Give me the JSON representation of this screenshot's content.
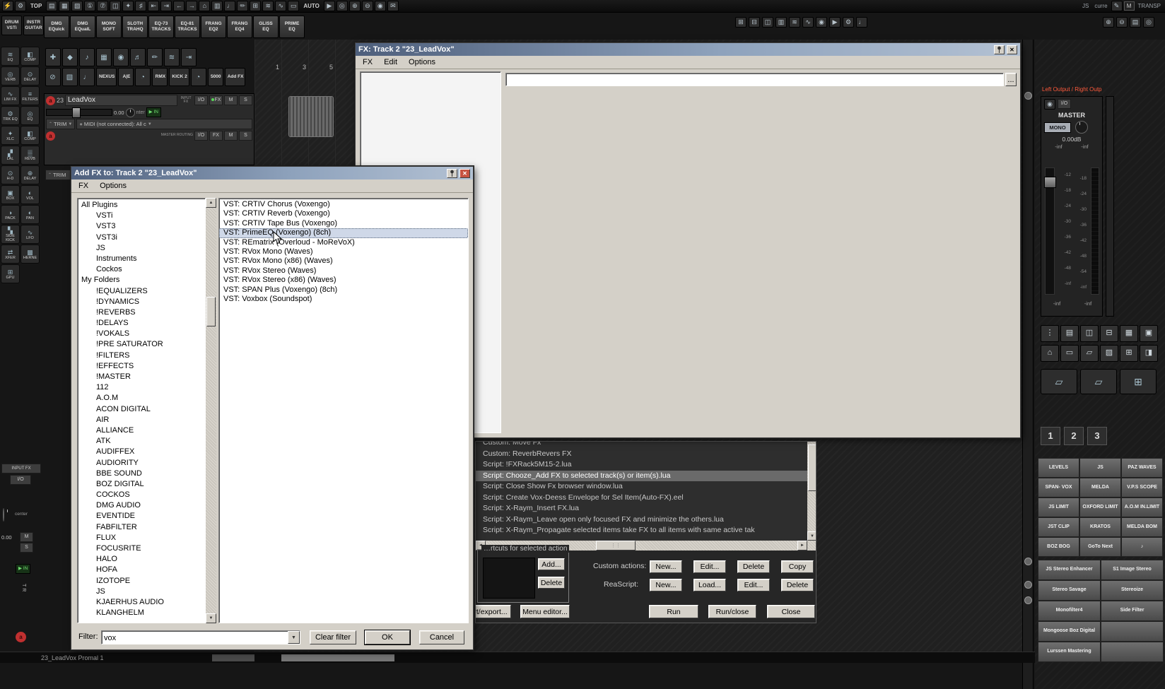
{
  "colors": {
    "titlebar_gradient_start": "#4e5f7c",
    "titlebar_gradient_end": "#b3c1d3",
    "window_chrome": "#d4d0c8",
    "selection_highlight": "#cfd8e8",
    "actions_selection": "#6a6a6a",
    "record_red": "#c03030",
    "output_label_red": "#ff5a3c",
    "monitor_green": "#6fe06f"
  },
  "top_toolbar": {
    "icons": [
      {
        "g": "⚡",
        "n": "actions-icon"
      },
      {
        "g": "⚙",
        "n": "gear-icon"
      },
      {
        "g": "TOP",
        "n": "top-label",
        "lbl": true
      },
      {
        "g": "▤",
        "n": "project-icon"
      },
      {
        "g": "▦",
        "n": "grid-icon"
      },
      {
        "g": "▧",
        "n": "mixer-icon"
      },
      {
        "g": "①",
        "n": "layout-1-icon"
      },
      {
        "g": "⑦",
        "n": "layout-7-icon"
      },
      {
        "g": "◫",
        "n": "split-view-icon"
      },
      {
        "g": "✦",
        "n": "snap-icon"
      },
      {
        "g": "♯",
        "n": "snap-grid-icon"
      },
      {
        "g": "⇤",
        "n": "go-start-icon"
      },
      {
        "g": "⇥",
        "n": "go-end-icon"
      },
      {
        "g": "←",
        "n": "nav-left-icon"
      },
      {
        "g": "→",
        "n": "nav-right-icon"
      },
      {
        "g": "⌂",
        "n": "home-icon"
      },
      {
        "g": "▥",
        "n": "tracks-icon"
      },
      {
        "g": "♩",
        "n": "midi-icon"
      },
      {
        "g": "✏",
        "n": "pencil-icon"
      },
      {
        "g": "⊞",
        "n": "add-track-icon"
      },
      {
        "g": "≋",
        "n": "envelope-icon"
      },
      {
        "g": "∿",
        "n": "waveform-icon"
      },
      {
        "g": "▭",
        "n": "item-icon"
      },
      {
        "g": "AUTO",
        "n": "auto-label",
        "lbl": true
      },
      {
        "g": "▶",
        "n": "play-icon"
      },
      {
        "g": "◎",
        "n": "locate-icon"
      },
      {
        "g": "⊕",
        "n": "zoom-in-icon"
      },
      {
        "g": "⊖",
        "n": "zoom-out-icon"
      },
      {
        "g": "◉",
        "n": "record-icon"
      },
      {
        "g": "✉",
        "n": "notes-icon"
      }
    ],
    "right": {
      "js": "JS",
      "curre": "curre",
      "pencil": "✎",
      "m": "M",
      "transp": "TRANSP"
    }
  },
  "top_right_icons": [
    {
      "g": "⊞",
      "n": "add-fx-icon"
    },
    {
      "g": "⊟",
      "n": "remove-fx-icon"
    },
    {
      "g": "◫",
      "n": "dock-icon"
    },
    {
      "g": "▥",
      "n": "track-manager-icon"
    },
    {
      "g": "≋",
      "n": "envelope-panel-icon"
    },
    {
      "g": "∿",
      "n": "oscilloscope-icon"
    },
    {
      "g": "◉",
      "n": "record-mode-icon"
    },
    {
      "g": "▶",
      "n": "play-mode-icon"
    },
    {
      "g": "⚙",
      "n": "settings-icon"
    },
    {
      "g": "♩",
      "n": "metronome-icon"
    }
  ],
  "top_right_icons2": [
    {
      "g": "⊕",
      "n": "zoom-in-icon"
    },
    {
      "g": "⊖",
      "n": "zoom-out-icon"
    },
    {
      "g": "▤",
      "n": "layout-icon"
    },
    {
      "g": "◎",
      "n": "target-icon"
    }
  ],
  "badges": {
    "badge1": {
      "l1": "DRUM",
      "l2": "VSTi"
    },
    "badge2": {
      "l1": "INSTR",
      "l2": "GUITAR"
    }
  },
  "preset_toolbar": [
    {
      "l1": "DMG",
      "l2": "EQuick"
    },
    {
      "l1": "DMG",
      "l2": "EQualL"
    },
    {
      "l1": "MONO",
      "l2": "SOFT"
    },
    {
      "l1": "SLOTH",
      "l2": "TRAHQ"
    },
    {
      "l1": "EQ-73",
      "l2": "TRACKS"
    },
    {
      "l1": "EQ-81",
      "l2": "TRACKS"
    },
    {
      "l1": "FRANG",
      "l2": "EQ2"
    },
    {
      "l1": "FRANG",
      "l2": "EQ4"
    },
    {
      "l1": "GLISS",
      "l2": "EQ"
    },
    {
      "l1": "PRIME",
      "l2": "EQ"
    }
  ],
  "left_rail": [
    {
      "g": "≋",
      "label": "EQ"
    },
    {
      "g": "◧",
      "label": "COMP"
    },
    {
      "g": "◎",
      "label": "VERB"
    },
    {
      "g": "⊙",
      "label": "DELAY"
    },
    {
      "g": "∿",
      "label": "LIM FX"
    },
    {
      "g": "≡",
      "label": "FILTERS"
    },
    {
      "g": "⚙",
      "label": "TRK EQ"
    },
    {
      "g": "◎",
      "label": "EQ"
    },
    {
      "g": "✦",
      "label": "XLC"
    },
    {
      "g": "◧",
      "label": "COMP"
    },
    {
      "g": "▞",
      "label": "LAL"
    },
    {
      "g": "▒",
      "label": "REVB"
    },
    {
      "g": "⊙",
      "label": "H-D"
    },
    {
      "g": "⊕",
      "label": "DELAY"
    },
    {
      "g": "▣",
      "label": "BOX"
    },
    {
      "g": "◐",
      "label": "VOL"
    },
    {
      "g": "◑",
      "label": "PACK"
    },
    {
      "g": "◐",
      "label": "PAN"
    },
    {
      "g": "▚",
      "label": "SIDE KICK"
    },
    {
      "g": "∿",
      "label": "LFO"
    },
    {
      "g": "⇄",
      "label": "XFER"
    },
    {
      "g": "▩",
      "label": "HERNE"
    },
    {
      "g": "⊞",
      "label": "GPU"
    }
  ],
  "track_tools_a": [
    {
      "g": "✚",
      "n": "add-tool-icon"
    },
    {
      "g": "◆",
      "n": "diamond-tool-icon"
    },
    {
      "g": "♪",
      "n": "note-tool-icon"
    },
    {
      "g": "▦",
      "n": "grid-tool-icon"
    },
    {
      "g": "◉",
      "n": "mic-tool-icon"
    },
    {
      "g": "♬",
      "n": "notes-tool-icon"
    },
    {
      "g": "✏",
      "n": "draw-tool-icon"
    },
    {
      "g": "≋",
      "n": "fade-tool-icon"
    },
    {
      "g": "⇥",
      "n": "end-tool-icon"
    }
  ],
  "track_tools_b": [
    {
      "g": "⊘",
      "n": "bypass-icon"
    },
    {
      "g": "▧",
      "n": "pattern-icon"
    },
    {
      "g": "♩",
      "n": "midi-note-icon"
    },
    {
      "t": "NEXUS",
      "n": "nexus-button"
    },
    {
      "t": "A|E",
      "n": "ae-button"
    },
    {
      "g": "◔",
      "n": "clock-icon"
    },
    {
      "t": "RMX",
      "n": "rmx-button"
    },
    {
      "t": "KICK 2",
      "n": "kick2-button"
    },
    {
      "g": "◔",
      "n": "clock2-icon"
    },
    {
      "t": "5000",
      "n": "5000-button"
    },
    {
      "t": "Add FX",
      "n": "add-fx-button"
    }
  ],
  "track_panel": {
    "track1": {
      "arm": "a",
      "number": "23",
      "name": "LeadVox",
      "input_fx": "INPUT FX",
      "io": "I/O",
      "fx": "FX",
      "mute": "M",
      "solo": "S",
      "volume": "0.00",
      "pan": "nter",
      "monitor": "IN",
      "trim": "TRIM",
      "midi": "MIDI (not connected): All c"
    },
    "track2": {
      "arm": "a",
      "routing": "MASTER ROUTING",
      "io": "I/O",
      "fx": "FX",
      "mute": "M",
      "solo": "S",
      "trim": "TRIM"
    }
  },
  "ruler_marks": [
    "1",
    "3",
    "5"
  ],
  "fx_window": {
    "title": "FX: Track 2 \"23_LeadVox\"",
    "menu": [
      "FX",
      "Edit",
      "Options"
    ],
    "browse": "..."
  },
  "addfx": {
    "title": "Add FX to: Track 2 \"23_LeadVox\"",
    "menu": [
      "FX",
      "Options"
    ],
    "tree": [
      {
        "label": "All Plugins",
        "sel": true
      },
      {
        "label": "VSTi",
        "ind": true
      },
      {
        "label": "VST3",
        "ind": true
      },
      {
        "label": "VST3i",
        "ind": true
      },
      {
        "label": "JS",
        "ind": true
      },
      {
        "label": "Instruments",
        "ind": true
      },
      {
        "label": "Cockos",
        "ind": true
      },
      {
        "label": "My Folders"
      },
      {
        "label": "!EQUALIZERS",
        "ind": true
      },
      {
        "label": "!DYNAMICS",
        "ind": true
      },
      {
        "label": "!REVERBS",
        "ind": true
      },
      {
        "label": "!DELAYS",
        "ind": true
      },
      {
        "label": "!VOKALS",
        "ind": true
      },
      {
        "label": "!PRE SATURATOR",
        "ind": true
      },
      {
        "label": "!FILTERS",
        "ind": true
      },
      {
        "label": "!EFFECTS",
        "ind": true
      },
      {
        "label": "!MASTER",
        "ind": true
      },
      {
        "label": "112",
        "ind": true
      },
      {
        "label": "A.O.M",
        "ind": true
      },
      {
        "label": "ACON DIGITAL",
        "ind": true
      },
      {
        "label": "AIR",
        "ind": true
      },
      {
        "label": "ALLIANCE",
        "ind": true
      },
      {
        "label": "ATK",
        "ind": true
      },
      {
        "label": "AUDIFFEX",
        "ind": true
      },
      {
        "label": "AUDIORITY",
        "ind": true
      },
      {
        "label": "BBE SOUND",
        "ind": true
      },
      {
        "label": "BOZ DIGITAL",
        "ind": true
      },
      {
        "label": "COCKOS",
        "ind": true
      },
      {
        "label": "DMG AUDIO",
        "ind": true
      },
      {
        "label": "EVENTIDE",
        "ind": true
      },
      {
        "label": "FABFILTER",
        "ind": true
      },
      {
        "label": "FLUX",
        "ind": true
      },
      {
        "label": "FOCUSRITE",
        "ind": true
      },
      {
        "label": "HALO",
        "ind": true
      },
      {
        "label": "HOFA",
        "ind": true
      },
      {
        "label": "IZOTOPE",
        "ind": true
      },
      {
        "label": "JS",
        "ind": true
      },
      {
        "label": "KJAERHUS AUDIO",
        "ind": true
      },
      {
        "label": "KLANGHELM",
        "ind": true
      }
    ],
    "plugins": [
      {
        "label": "VST: CRTIV Chorus (Voxengo)"
      },
      {
        "label": "VST: CRTIV Reverb (Voxengo)"
      },
      {
        "label": "VST: CRTIV Tape Bus (Voxengo)"
      },
      {
        "label": "VST: PrimeEQ (Voxengo) (8ch)",
        "sel": true
      },
      {
        "label": "VST: REmatrix (Overloud - MoReVoX)"
      },
      {
        "label": "VST: RVox Mono (Waves)"
      },
      {
        "label": "VST: RVox Mono (x86) (Waves)"
      },
      {
        "label": "VST: RVox Stereo (Waves)"
      },
      {
        "label": "VST: RVox Stereo (x86) (Waves)"
      },
      {
        "label": "VST: SPAN Plus (Voxengo) (8ch)"
      },
      {
        "label": "VST: Voxbox (Soundspot)"
      }
    ],
    "filter_label": "Filter:",
    "filter_value": "vox",
    "clear_filter": "Clear filter",
    "ok": "OK",
    "cancel": "Cancel"
  },
  "actions": {
    "rows": [
      {
        "label": "Custom: Move Fx"
      },
      {
        "label": "Custom: ReverbRevers FX"
      },
      {
        "label": "Script: !FXRack5M15-2.lua"
      },
      {
        "label": "Script: Chooze_Add FX to selected track(s) or item(s).lua",
        "sel": true
      },
      {
        "label": "Script: Close Show Fx browser window.lua"
      },
      {
        "label": "Script: Create Vox-Deess Envelope for Sel Item(Auto-FX).eel"
      },
      {
        "label": "Script: X-Raym_Insert FX.lua"
      },
      {
        "label": "Script: X-Raym_Leave open only focused FX and minimize the others.lua"
      },
      {
        "label": "Script: X-Raym_Propagate selected items take FX to all items with same active tak"
      }
    ],
    "shortcuts_label": "…rtcuts for selected action",
    "add": "Add...",
    "del": "Delete",
    "custom_label": "Custom actions:",
    "custom_buttons": [
      "New...",
      "Edit...",
      "Delete",
      "Copy"
    ],
    "reascript_label": "ReaScript:",
    "reascript_buttons": [
      "New...",
      "Load...",
      "Edit...",
      "Delete"
    ],
    "run": "Run",
    "run_close": "Run/close",
    "close": "Close",
    "import_export": "rt/export...",
    "menu_editor": "Menu editor..."
  },
  "mixer": {
    "routing_label": "Left Output / Right Outp",
    "power": "◉",
    "io": "I/O",
    "master": "MASTER",
    "mono": "MONO",
    "gain": "0.00dB",
    "peaks": [
      "-inf",
      "-inf"
    ],
    "scale_left": [
      "-12",
      "-18",
      "-24",
      "-30",
      "-36",
      "-42",
      "-48",
      "-inf"
    ],
    "scale_right": [
      "-18",
      "-24",
      "-30",
      "-36",
      "-42",
      "-48",
      "-54",
      "-inf"
    ],
    "bottom_peaks": [
      "-inf",
      "-inf"
    ],
    "toolA": [
      {
        "g": "⋮",
        "n": "routing-icon"
      },
      {
        "g": "▤",
        "n": "fx-chain-icon"
      },
      {
        "g": "◫",
        "n": "dock-icon"
      },
      {
        "g": "⊟",
        "n": "minimize-icon"
      },
      {
        "g": "▦",
        "n": "sends-icon"
      },
      {
        "g": "▣",
        "n": "env-icon"
      }
    ],
    "toolB": [
      {
        "g": "⌂",
        "n": "home-icon"
      },
      {
        "g": "▭",
        "n": "item-icon"
      },
      {
        "g": "▱",
        "n": "folder-icon"
      },
      {
        "g": "▨",
        "n": "pattern-icon"
      },
      {
        "g": "⊞",
        "n": "add-icon"
      },
      {
        "g": "◨",
        "n": "pane-icon"
      }
    ],
    "bigbtns": [
      {
        "g": "▱",
        "n": "open-folder-icon"
      },
      {
        "g": "▱",
        "n": "save-folder-icon"
      },
      {
        "g": "⊞",
        "n": "add-screenset-icon"
      }
    ],
    "banks": [
      "1",
      "2",
      "3"
    ],
    "slots3": [
      {
        "label": "LEVELS"
      },
      {
        "label": "JS"
      },
      {
        "label": "PAZ WAVES"
      },
      {
        "label": "SPAN- VOX"
      },
      {
        "label": "MELDA"
      },
      {
        "label": "V.P.S SCOPE"
      },
      {
        "label": "JS LIMIT"
      },
      {
        "label": "OXFORD LIMIT"
      },
      {
        "label": "A.O.M IN.LIMIT"
      },
      {
        "label": "JST CLIP"
      },
      {
        "label": "KRATOS"
      },
      {
        "label": "MELDA BOM"
      },
      {
        "label": "BOZ BOG"
      },
      {
        "label": "GoTo Next"
      },
      {
        "label": "♪"
      }
    ],
    "slots2": [
      {
        "label": "JS Stereo Enhancer"
      },
      {
        "label": "S1 Image Stereo"
      },
      {
        "label": "Stereo Savage"
      },
      {
        "label": "Stereoize"
      },
      {
        "label": "Monofilter4"
      },
      {
        "label": "Side Filter"
      },
      {
        "label": "Mongoose Boz Digital"
      },
      {
        "label": ""
      },
      {
        "label": "Lurssen Mastering"
      },
      {
        "label": ""
      }
    ]
  },
  "bottom_left": {
    "inputfx": "INPUT FX",
    "io": "I/O",
    "center": "center",
    "vol": "0.00",
    "mute": "M",
    "solo": "S",
    "monitor": "IN",
    "tr": "TR",
    "arm": "a"
  },
  "status": {
    "text": "23_LeadVox Promal 1"
  }
}
